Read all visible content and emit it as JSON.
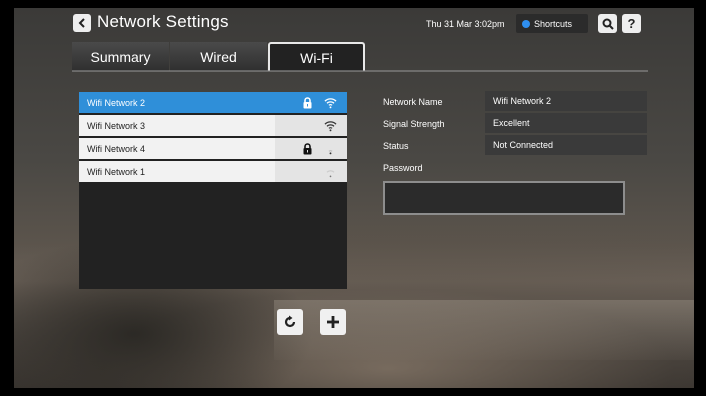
{
  "header": {
    "title": "Network Settings",
    "datetime": "Thu 31 Mar 3:02pm",
    "shortcuts_label": "Shortcuts",
    "help_label": "?"
  },
  "tabs": [
    {
      "label": "Summary",
      "active": false
    },
    {
      "label": "Wired",
      "active": false
    },
    {
      "label": "Wi-Fi",
      "active": true
    }
  ],
  "networks": [
    {
      "name": "Wifi Network 2",
      "locked": true,
      "signal": "excellent",
      "selected": true
    },
    {
      "name": "Wifi Network 3",
      "locked": false,
      "signal": "excellent",
      "selected": false
    },
    {
      "name": "Wifi Network 4",
      "locked": true,
      "signal": "weak",
      "selected": false
    },
    {
      "name": "Wifi Network 1",
      "locked": false,
      "signal": "very-weak",
      "selected": false
    }
  ],
  "details": {
    "network_name_label": "Network Name",
    "network_name_value": "Wifi Network 2",
    "signal_strength_label": "Signal Strength",
    "signal_strength_value": "Excellent",
    "status_label": "Status",
    "status_value": "Not Connected",
    "password_label": "Password",
    "password_value": ""
  },
  "colors": {
    "selected_row": "#2f8fd9",
    "shortcut_dot": "#2f8ff0"
  },
  "icons": [
    "back-icon",
    "search-icon",
    "help-icon",
    "lock-icon",
    "wifi-icon",
    "refresh-icon",
    "plus-icon"
  ]
}
